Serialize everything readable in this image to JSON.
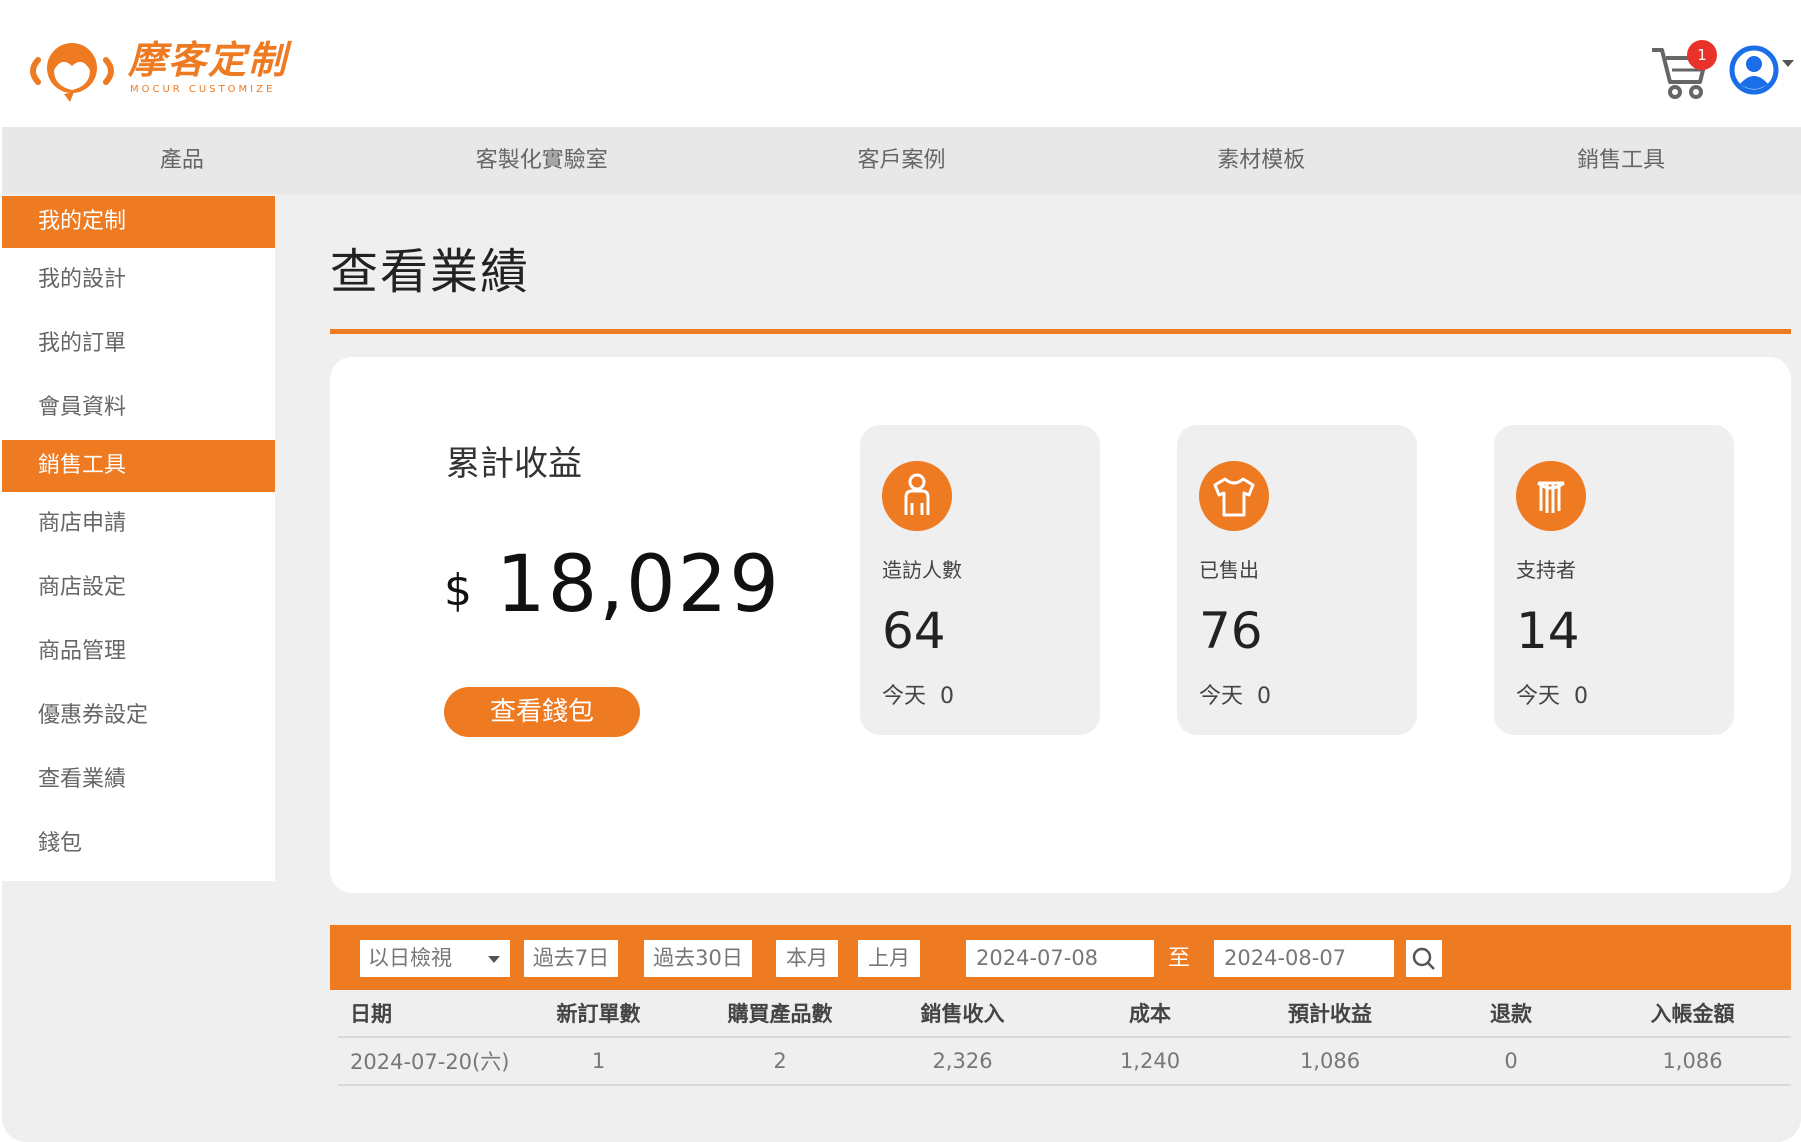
{
  "brand": {
    "title": "摩客定制",
    "subtitle": "MOCUR CUSTOMIZE",
    "color": "#ee7a22"
  },
  "header": {
    "cart_icon": "shopping-cart-icon",
    "cart_count": "1",
    "account_icon": "user-account-icon"
  },
  "topnav": {
    "items": [
      "產品",
      "客製化實驗室",
      "客戶案例",
      "素材模板",
      "銷售工具"
    ]
  },
  "sidebar": {
    "items": [
      {
        "label": "我的定制",
        "active": true
      },
      {
        "label": "我的設計",
        "active": false
      },
      {
        "label": "我的訂單",
        "active": false
      },
      {
        "label": "會員資料",
        "active": false
      },
      {
        "label": "銷售工具",
        "active": true
      },
      {
        "label": "商店申請",
        "active": false
      },
      {
        "label": "商店設定",
        "active": false
      },
      {
        "label": "商品管理",
        "active": false
      },
      {
        "label": "優惠券設定",
        "active": false
      },
      {
        "label": "查看業績",
        "active": false
      },
      {
        "label": "錢包",
        "active": false
      }
    ]
  },
  "main": {
    "title": "查看業績",
    "earnings": {
      "label": "累計收益",
      "currency": "$",
      "amount": "18,029",
      "wallet_button": "查看錢包"
    },
    "stats": [
      {
        "icon": "person-icon",
        "label": "造訪人數",
        "value": "64",
        "today_label": "今天",
        "today_value": "0"
      },
      {
        "icon": "tshirt-icon",
        "label": "已售出",
        "value": "76",
        "today_label": "今天",
        "today_value": "0"
      },
      {
        "icon": "supporters-icon",
        "label": "支持者",
        "value": "14",
        "today_label": "今天",
        "today_value": "0"
      }
    ]
  },
  "filter": {
    "view_select": "以日檢視",
    "quick_ranges": [
      "過去7日",
      "過去30日",
      "本月",
      "上月"
    ],
    "date_from": "2024-07-08",
    "to_label": "至",
    "date_to": "2024-08-07",
    "search_icon": "search-icon"
  },
  "table": {
    "headers": [
      "日期",
      "新訂單數",
      "購買產品數",
      "銷售收入",
      "成本",
      "預計收益",
      "退款",
      "入帳金額"
    ],
    "rows": [
      [
        "2024-07-20(六)",
        "1",
        "2",
        "2,326",
        "1,240",
        "1,086",
        "0",
        "1,086"
      ]
    ]
  }
}
